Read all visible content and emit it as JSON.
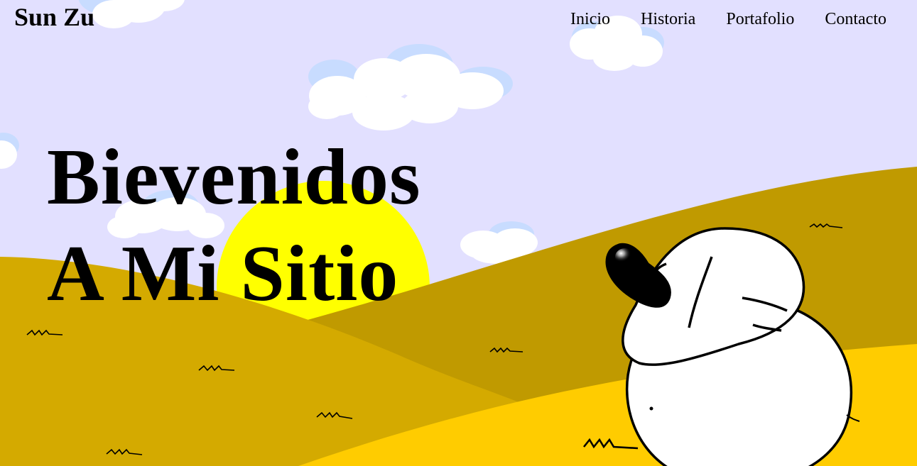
{
  "brand": {
    "name": "Sun Zu"
  },
  "nav": {
    "items": [
      {
        "label": "Inicio"
      },
      {
        "label": "Historia"
      },
      {
        "label": "Portafolio"
      },
      {
        "label": "Contacto"
      }
    ]
  },
  "hero": {
    "line1": "Bievenidos",
    "line2": "A Mi Sitio"
  },
  "colors": {
    "sky": "#e2e0ff",
    "sun": "#ffff00",
    "hill_back": "#c09a00",
    "hill_mid": "#d4aa00",
    "hill_front": "#ffcc00",
    "cloud": "#ffffff",
    "cloud_shade": "#c8dcff"
  }
}
